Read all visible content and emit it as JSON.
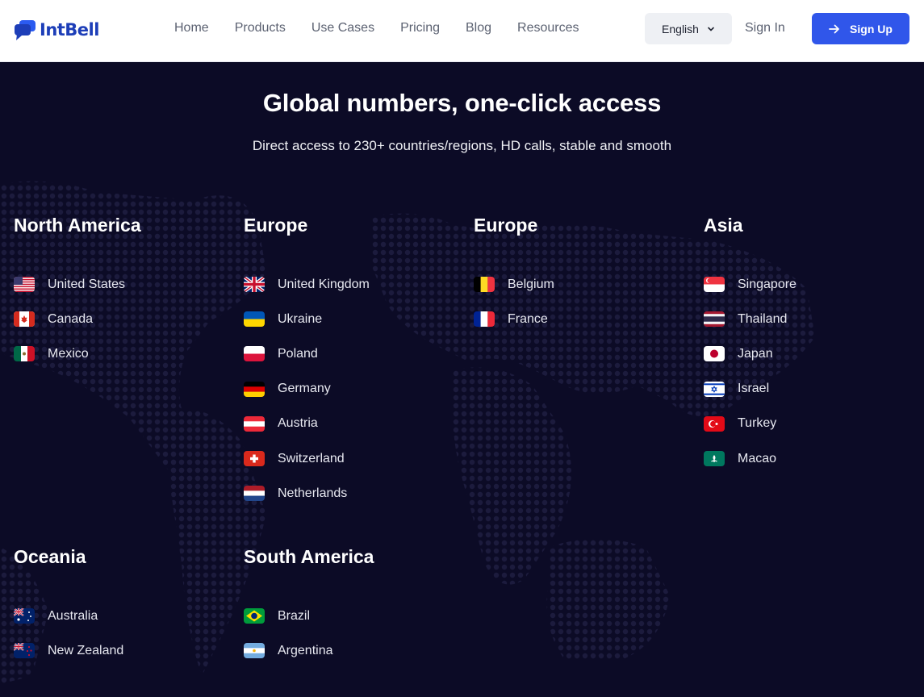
{
  "header": {
    "brand": "IntBell",
    "nav": [
      "Home",
      "Products",
      "Use Cases",
      "Pricing",
      "Blog",
      "Resources"
    ],
    "language": "English",
    "sign_in": "Sign In",
    "sign_up": "Sign Up"
  },
  "hero": {
    "title": "Global numbers, one-click access",
    "subtitle": "Direct access to 230+ countries/regions, HD calls, stable and smooth"
  },
  "regions": [
    {
      "title": "North America",
      "countries": [
        "United States",
        "Canada",
        "Mexico"
      ]
    },
    {
      "title": "Europe",
      "countries": [
        "United Kingdom",
        "Ukraine",
        "Poland",
        "Germany",
        "Austria",
        "Switzerland",
        "Netherlands"
      ]
    },
    {
      "title": "Europe",
      "countries": [
        "Belgium",
        "France"
      ]
    },
    {
      "title": "Asia",
      "countries": [
        "Singapore",
        "Thailand",
        "Japan",
        "Israel",
        "Turkey",
        "Macao"
      ]
    },
    {
      "title": "Oceania",
      "countries": [
        "Australia",
        "New Zealand"
      ]
    },
    {
      "title": "South America",
      "countries": [
        "Brazil",
        "Argentina"
      ]
    }
  ],
  "colors": {
    "brand": "#1d3eb8",
    "accent": "#3056ea",
    "background": "#0c0b26"
  }
}
